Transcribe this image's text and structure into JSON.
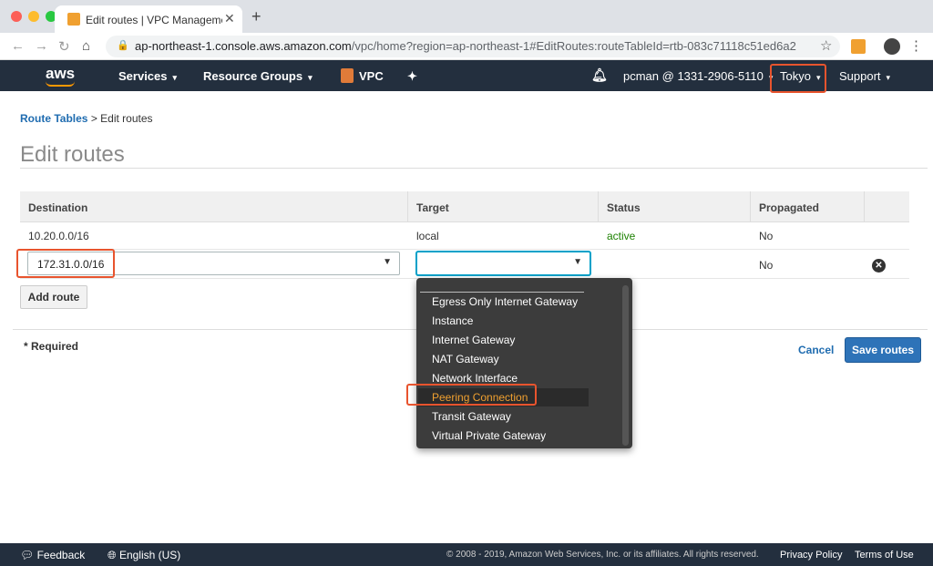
{
  "browser": {
    "tab_title": "Edit routes | VPC Management",
    "url_host": "ap-northeast-1.console.aws.amazon.com",
    "url_path": "/vpc/home?region=ap-northeast-1#EditRoutes:routeTableId=rtb-083c71118c51ed6a2"
  },
  "nav": {
    "logo": "aws",
    "services": "Services",
    "resource_groups": "Resource Groups",
    "vpc": "VPC",
    "account": "pcman @ 1331-2906-5110",
    "region": "Tokyo",
    "support": "Support"
  },
  "breadcrumb": {
    "parent": "Route Tables",
    "separator": ">",
    "current": "Edit routes"
  },
  "page_title": "Edit routes",
  "table": {
    "headers": [
      "Destination",
      "Target",
      "Status",
      "Propagated"
    ],
    "rows": [
      {
        "destination": "10.20.0.0/16",
        "target": "local",
        "status": "active",
        "propagated": "No"
      },
      {
        "destination": "172.31.0.0/16",
        "target": "",
        "status": "",
        "propagated": "No"
      }
    ]
  },
  "buttons": {
    "add_route": "Add route",
    "cancel": "Cancel",
    "save": "Save routes"
  },
  "required_note": "* Required",
  "dropdown": {
    "options": [
      "Egress Only Internet Gateway",
      "Instance",
      "Internet Gateway",
      "NAT Gateway",
      "Network Interface",
      "Peering Connection",
      "Transit Gateway",
      "Virtual Private Gateway"
    ],
    "highlighted": "Peering Connection"
  },
  "footer": {
    "feedback": "Feedback",
    "language": "English (US)",
    "copyright": "© 2008 - 2019, Amazon Web Services, Inc. or its affiliates. All rights reserved.",
    "privacy": "Privacy Policy",
    "terms": "Terms of Use"
  },
  "colors": {
    "aws_nav": "#232f3e",
    "accent_orange": "#ff9900",
    "highlight_red": "#e8542e",
    "link_blue": "#1f6cb0",
    "status_green": "#1d8102",
    "primary_button": "#2e73b8"
  }
}
